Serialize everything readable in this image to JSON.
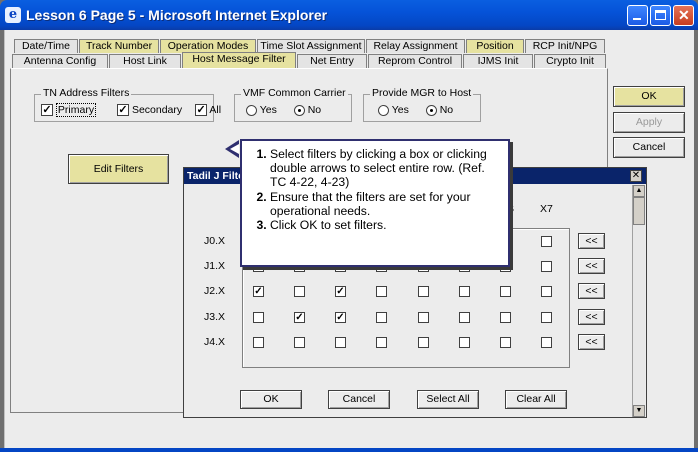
{
  "window": {
    "title": "Lesson 6 Page 5 - Microsoft Internet Explorer"
  },
  "tabs_row1": [
    "Date/Time",
    "Track Number",
    "Operation Modes",
    "Time Slot Assignment",
    "Relay Assignment",
    "Position",
    "RCP Init/NPG"
  ],
  "tabs_row2": [
    "Antenna Config",
    "Host Link",
    "Host Message Filter",
    "Net Entry",
    "Reprom Control",
    "IJMS Init",
    "Crypto Init"
  ],
  "tn_filters": {
    "title": "TN Address Filters",
    "primary": "Primary",
    "secondary": "Secondary",
    "all": "All"
  },
  "vmf": {
    "title": "VMF Common Carrier",
    "yes": "Yes",
    "no": "No"
  },
  "mgr": {
    "title": "Provide MGR to Host",
    "yes": "Yes",
    "no": "No"
  },
  "buttons": {
    "edit_filters": "Edit Filters",
    "ok": "OK",
    "apply": "Apply",
    "cancel": "Cancel"
  },
  "dialog": {
    "title": "Tadil J Filte",
    "col_partial": "S",
    "col_x7": "X7",
    "rows": [
      "J0.X",
      "J1.X",
      "J2.X",
      "J3.X",
      "J4.X"
    ],
    "ok": "OK",
    "cancel": "Cancel",
    "select_all": "Select All",
    "clear_all": "Clear All",
    "arrow": "<<"
  },
  "callout": {
    "steps": [
      "Select filters by clicking a box or clicking double arrows to select entire row. (Ref. TC 4-22, 4-23)",
      "Ensure that the filters are set for your operational needs.",
      "Click OK to set filters."
    ]
  },
  "checkmarks": {
    "J2.X": [
      true,
      false,
      true,
      false,
      false,
      false,
      false,
      false
    ],
    "J3.X": [
      false,
      true,
      true,
      false,
      false,
      false,
      false,
      false
    ],
    "J4.X": [
      false,
      false,
      false,
      false,
      false,
      false,
      false,
      false
    ],
    "J1.X": [
      false,
      false,
      false,
      false,
      false,
      false,
      false,
      false
    ],
    "J0.X": [
      false,
      false,
      false,
      false,
      false,
      false,
      false,
      false
    ]
  }
}
